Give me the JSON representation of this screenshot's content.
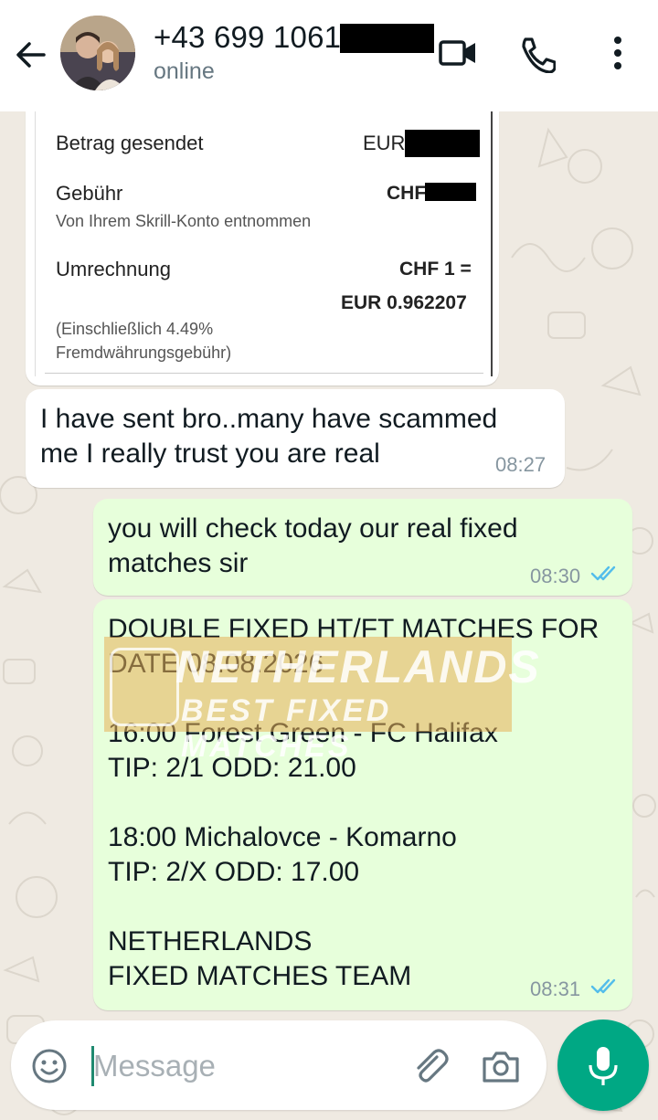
{
  "header": {
    "contact_name": "+43 699 1061",
    "status": "online",
    "icons": [
      "back-arrow-icon",
      "video-call-icon",
      "voice-call-icon",
      "more-options-icon"
    ]
  },
  "receipt": {
    "rows": [
      {
        "label": "Betrag gesendet",
        "value": "EUR"
      },
      {
        "label": "Gebühr",
        "value": "CHF",
        "sub": "Von Ihrem Skrill-Konto entnommen"
      },
      {
        "label": "Umrechnung",
        "value": "CHF 1 =",
        "value2": "EUR 0.962207",
        "sub": "(Einschließlich 4.49%",
        "sub2": "Fremdwährungsgebühr)"
      }
    ]
  },
  "messages": [
    {
      "direction": "incoming",
      "lines": [
        "I have sent bro..many have scammed",
        "me I really trust you are real"
      ],
      "time": "08:27"
    },
    {
      "direction": "outgoing",
      "lines": [
        "you will check today our real fixed",
        "matches sir"
      ],
      "time": "08:30",
      "status": "read"
    },
    {
      "direction": "outgoing",
      "lines": [
        "DOUBLE FIXED HT/FT MATCHES FOR",
        "DATE 08.08.2026",
        "",
        "16:00  Forest Green - FC Halifax",
        "TIP: 2/1  ODD: 21.00",
        "",
        "18:00  Michalovce - Komarno",
        "TIP: 2/X  ODD: 17.00",
        "",
        "NETHERLANDS",
        "FIXED MATCHES TEAM"
      ],
      "time": "08:31",
      "status": "read"
    }
  ],
  "watermark": {
    "line1": "NETHERLANDS",
    "line2": "BEST FIXED MATCHES"
  },
  "composer": {
    "placeholder": "Message",
    "icons": [
      "emoji-icon",
      "attach-icon",
      "camera-icon",
      "mic-icon"
    ]
  },
  "colors": {
    "outgoing_bubble": "#e7ffdb",
    "accent": "#00a884",
    "read_ticks": "#53bdeb"
  }
}
